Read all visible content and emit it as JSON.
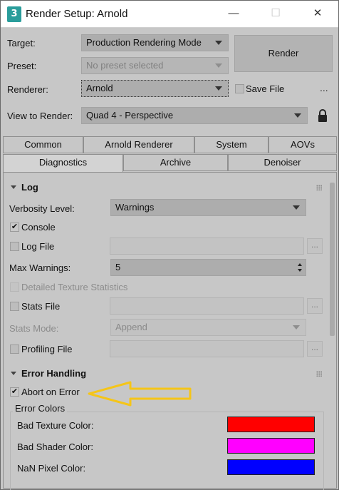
{
  "window": {
    "app_icon_text": "3",
    "title": "Render Setup: Arnold",
    "minimize_glyph": "—",
    "maximize_glyph": "☐",
    "close_glyph": "✕"
  },
  "header": {
    "target_label": "Target:",
    "target_value": "Production Rendering Mode",
    "preset_label": "Preset:",
    "preset_value": "No preset selected",
    "renderer_label": "Renderer:",
    "renderer_value": "Arnold",
    "render_button": "Render",
    "save_file_label": "Save File",
    "save_file_checked": false,
    "more_button": "...",
    "view_label": "View to Render:",
    "view_value": "Quad 4 - Perspective",
    "lock_icon": "lock-icon"
  },
  "tabs": {
    "row1": [
      "Common",
      "Arnold Renderer",
      "System",
      "AOVs"
    ],
    "row2": [
      "Diagnostics",
      "Archive",
      "Denoiser"
    ],
    "active": "Diagnostics"
  },
  "log": {
    "title": "Log",
    "verbosity_label": "Verbosity Level:",
    "verbosity_value": "Warnings",
    "console_label": "Console",
    "console_checked": true,
    "log_file_label": "Log File",
    "log_file_checked": false,
    "max_warnings_label": "Max Warnings:",
    "max_warnings_value": "5",
    "detailed_label": "Detailed Texture Statistics",
    "stats_file_label": "Stats File",
    "stats_mode_label": "Stats Mode:",
    "stats_mode_value": "Append",
    "profiling_label": "Profiling File",
    "browse_label": "..."
  },
  "error_handling": {
    "title": "Error Handling",
    "abort_label": "Abort on Error",
    "abort_checked": true,
    "group_label": "Error Colors",
    "bad_texture_label": "Bad Texture Color:",
    "bad_shader_label": "Bad Shader Color:",
    "nan_label": "NaN Pixel Color:",
    "colors": {
      "bad_texture": "#ff0000",
      "bad_shader": "#ff00ff",
      "nan_pixel": "#0000ff"
    },
    "annotation_arrow_color": "#f5c518"
  },
  "check_glyph": "✔"
}
